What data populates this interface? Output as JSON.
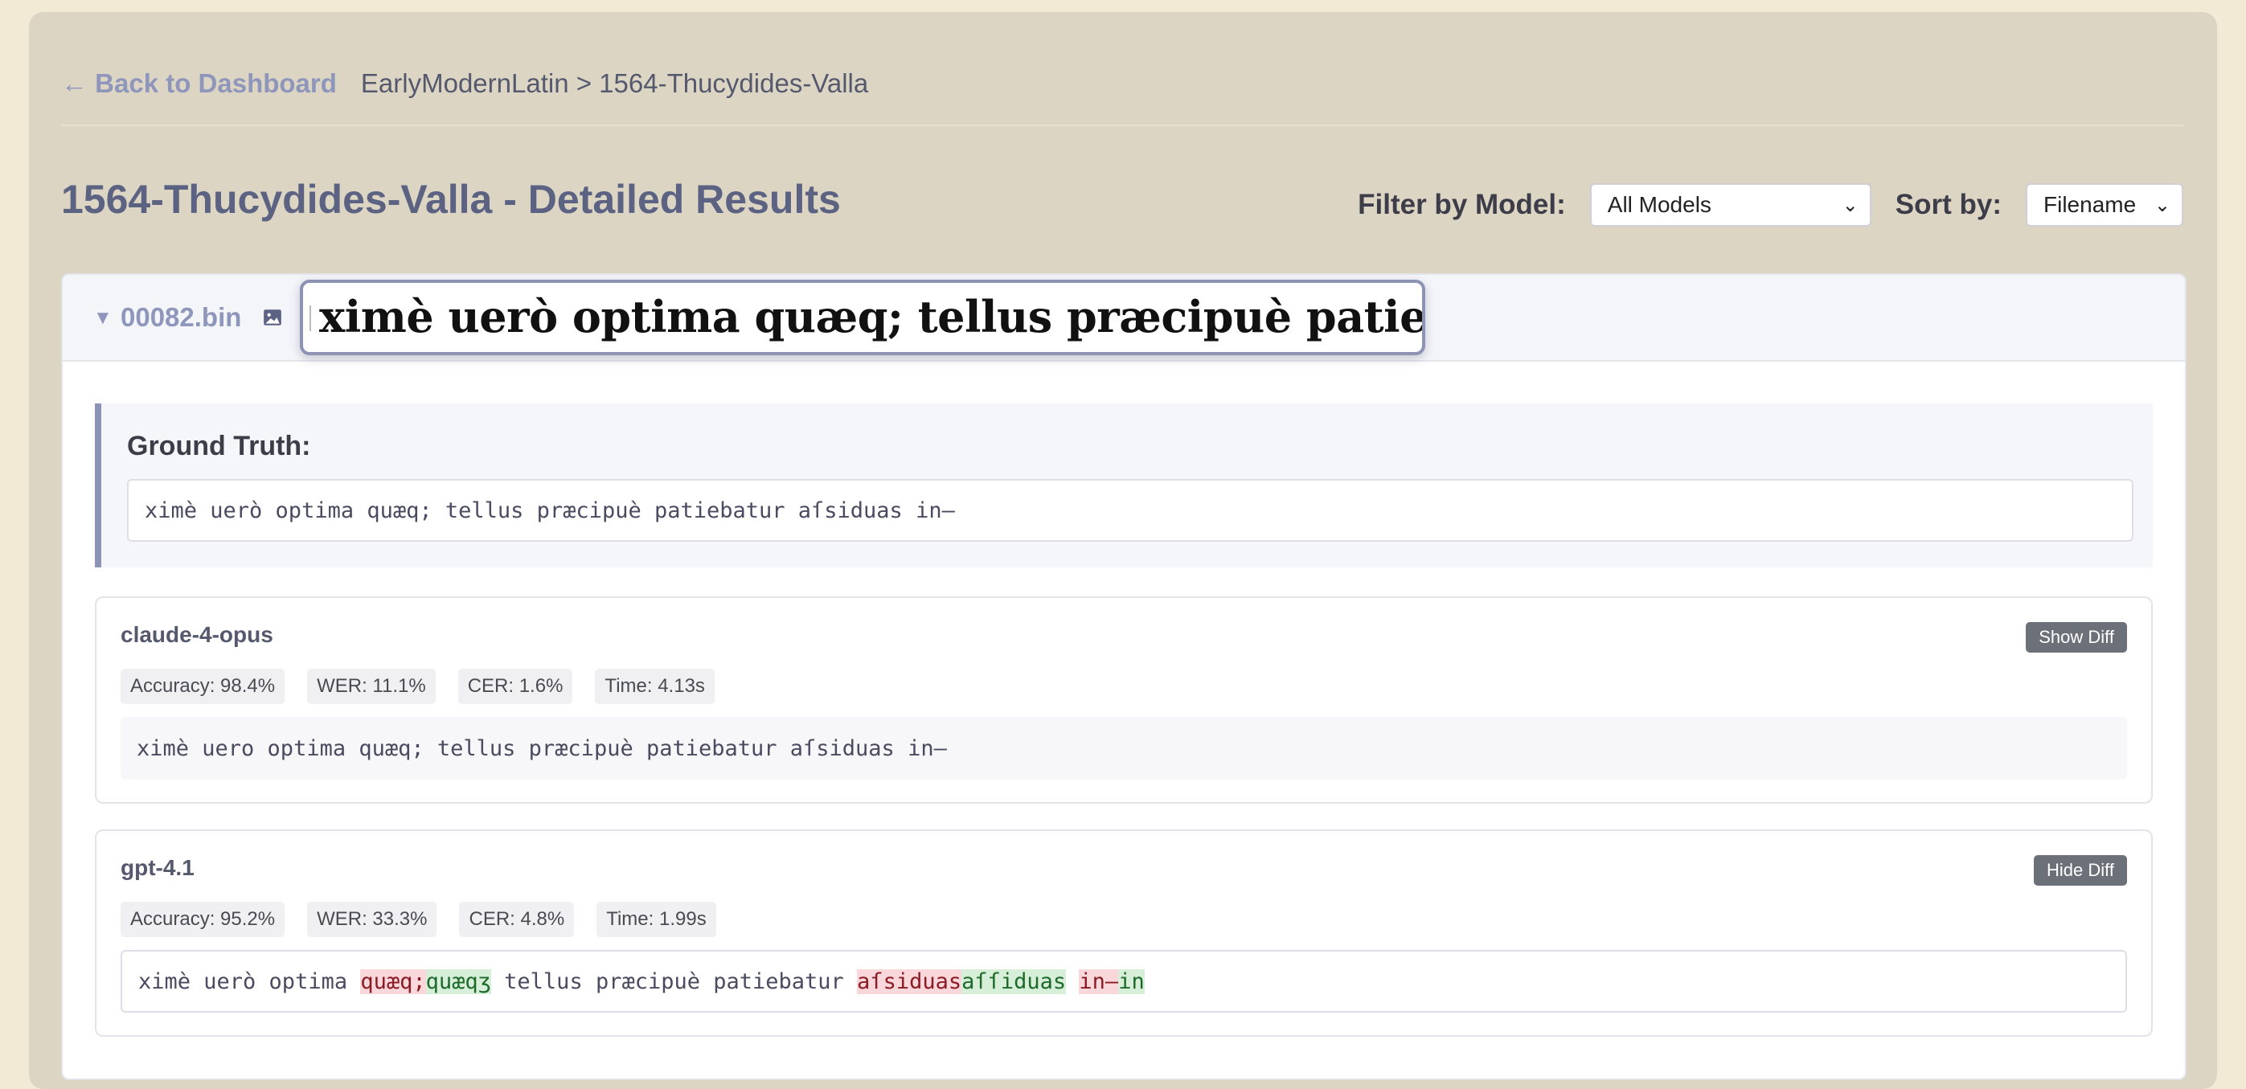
{
  "nav": {
    "back_label": "← Back to Dashboard",
    "breadcrumb": "EarlyModernLatin > 1564-Thucydides-Valla"
  },
  "page": {
    "title": "1564-Thucydides-Valla - Detailed Results"
  },
  "filters": {
    "model_label": "Filter by Model:",
    "model_value": "All Models",
    "sort_label": "Sort by:",
    "sort_value": "Filename"
  },
  "file": {
    "name": "00082.bin",
    "image_icon": "image-icon",
    "line_image_text": "ximè uerò optima quæq; tellus præcipuè patiebatur aſsiduas in-"
  },
  "ground_truth": {
    "label": "Ground Truth:",
    "text": "ximè uerò optima quæq; tellus præcipuè patiebatur aſsiduas in—"
  },
  "models": [
    {
      "name": "claude-4-opus",
      "button": "Show Diff",
      "accuracy": "Accuracy: 98.4%",
      "wer": "WER: 11.1%",
      "cer": "CER: 1.6%",
      "time": "Time: 4.13s",
      "output": "ximè uero optima quæq; tellus præcipuè patiebatur aſsiduas in—"
    },
    {
      "name": "gpt-4.1",
      "button": "Hide Diff",
      "accuracy": "Accuracy: 95.2%",
      "wer": "WER: 33.3%",
      "cer": "CER: 4.8%",
      "time": "Time: 1.99s",
      "diff": {
        "s1": "ximè uerò optima ",
        "d1": "quæq;",
        "i1": "quæqʒ",
        "s2": " tellus præcipuè patiebatur ",
        "d2": "aſsiduas",
        "i2": "aſſiduas",
        "s3": " ",
        "d3": "in—",
        "i3": "in"
      }
    }
  ]
}
